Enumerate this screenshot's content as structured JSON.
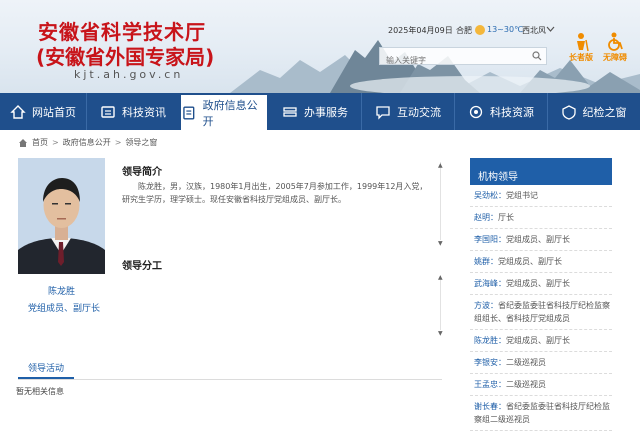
{
  "header": {
    "title": "安徽省科学技术厅",
    "subtitle": "(安徽省外国专家局)",
    "domain": "kjt.ah.gov.cn",
    "date": "2025年04月09日",
    "city": "合肥",
    "temperature": "13~30℃",
    "wind": "西北风",
    "search_placeholder": "输入关键字",
    "elder_label": "长者版",
    "barrier_free_label": "无障碍"
  },
  "nav": {
    "items": [
      {
        "label": "网站首页",
        "icon": "home-icon"
      },
      {
        "label": "科技资讯",
        "icon": "news-icon"
      },
      {
        "label": "政府信息公开",
        "icon": "info-icon"
      },
      {
        "label": "办事服务",
        "icon": "service-icon"
      },
      {
        "label": "互动交流",
        "icon": "chat-icon"
      },
      {
        "label": "科技资源",
        "icon": "resource-icon"
      },
      {
        "label": "纪检之窗",
        "icon": "discipline-icon"
      }
    ],
    "active_index": 2
  },
  "breadcrumb": [
    "首页",
    "政府信息公开",
    "领导之窗"
  ],
  "leader": {
    "name": "陈龙胜",
    "title": "党组成员、副厅长",
    "intro_heading": "领导简介",
    "intro_text": "陈龙胜，男，汉族，1980年1月出生，2005年7月参加工作，1999年12月入党，研究生学历，理学硕士。现任安徽省科技厅党组成员、副厅长。",
    "duty_heading": "领导分工"
  },
  "activity": {
    "tab_label": "领导活动",
    "empty_text": "暂无相关信息"
  },
  "sidebar": {
    "heading": "机构领导",
    "items": [
      {
        "name": "吴劲松：",
        "role": "党组书记"
      },
      {
        "name": "赵明：",
        "role": "厅长"
      },
      {
        "name": "李国阳：",
        "role": "党组成员、副厅长"
      },
      {
        "name": "姚群：",
        "role": "党组成员、副厅长"
      },
      {
        "name": "武海峰：",
        "role": "党组成员、副厅长"
      },
      {
        "name": "方波：",
        "role": "省纪委监委驻省科技厅纪检监察组组长、省科技厅党组成员"
      },
      {
        "name": "陈龙胜：",
        "role": "党组成员、副厅长"
      },
      {
        "name": "李银安：",
        "role": "二级巡视员"
      },
      {
        "name": "王孟忠：",
        "role": "二级巡视员"
      },
      {
        "name": "谢长春：",
        "role": "省纪委监委驻省科技厅纪检监察组二级巡视员"
      }
    ]
  },
  "colors": {
    "brand_red": "#c8141a",
    "nav_blue": "#1f4f8c",
    "link_blue": "#1f5fa8",
    "accent_orange": "#f08c00"
  }
}
